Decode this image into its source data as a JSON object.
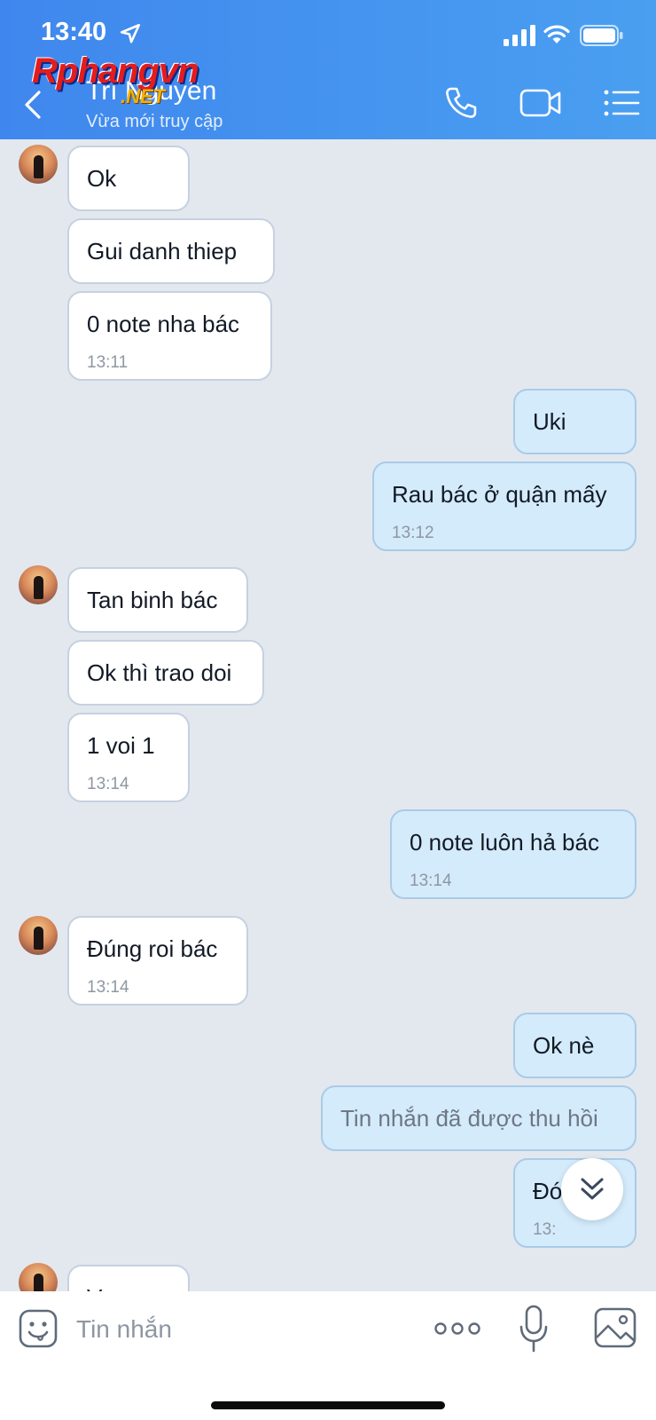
{
  "status_bar": {
    "time": "13:40"
  },
  "header": {
    "contact_name": "Trí Nguyễn",
    "contact_status": "Vừa mới truy cập",
    "watermark_main": "Rphangvn",
    "watermark_sub": ".NET"
  },
  "messages": [
    {
      "dir": "in",
      "text": "Ok",
      "time": ""
    },
    {
      "dir": "in",
      "text": "Gui danh thiep",
      "time": ""
    },
    {
      "dir": "in",
      "text": "0 note nha bác",
      "time": "13:11"
    },
    {
      "dir": "out",
      "text": "Uki",
      "time": ""
    },
    {
      "dir": "out",
      "text": "Rau bác ở quận mấy",
      "time": "13:12"
    },
    {
      "dir": "in",
      "text": "Tan binh bác",
      "time": ""
    },
    {
      "dir": "in",
      "text": "Ok thì trao doi",
      "time": ""
    },
    {
      "dir": "in",
      "text": "1 voi 1",
      "time": "13:14"
    },
    {
      "dir": "out",
      "text": "0 note luôn hả bác",
      "time": "13:14"
    },
    {
      "dir": "in",
      "text": "Đúng roi bác",
      "time": "13:14"
    },
    {
      "dir": "out",
      "text": "Ok nè",
      "time": ""
    },
    {
      "dir": "out",
      "text": "Tin nhắn đã được thu hồi",
      "time": "",
      "recalled": true
    },
    {
      "dir": "out",
      "text": "Đó bác",
      "time": "13:"
    },
    {
      "dir": "in",
      "text": "V",
      "time": ""
    }
  ],
  "input": {
    "placeholder": "Tin nhắn"
  },
  "icons": {
    "back": "chevron-left-icon",
    "call": "phone-icon",
    "video": "video-camera-icon",
    "menu": "list-menu-icon",
    "emoji": "emoji-icon",
    "more": "more-dots-icon",
    "mic": "microphone-icon",
    "image": "image-icon",
    "scroll": "double-chevron-down-icon"
  },
  "colors": {
    "header": "#3f87ee",
    "incoming_bubble": "#ffffff",
    "outgoing_bubble": "#d4ebfb",
    "background": "#e3e8ef"
  }
}
